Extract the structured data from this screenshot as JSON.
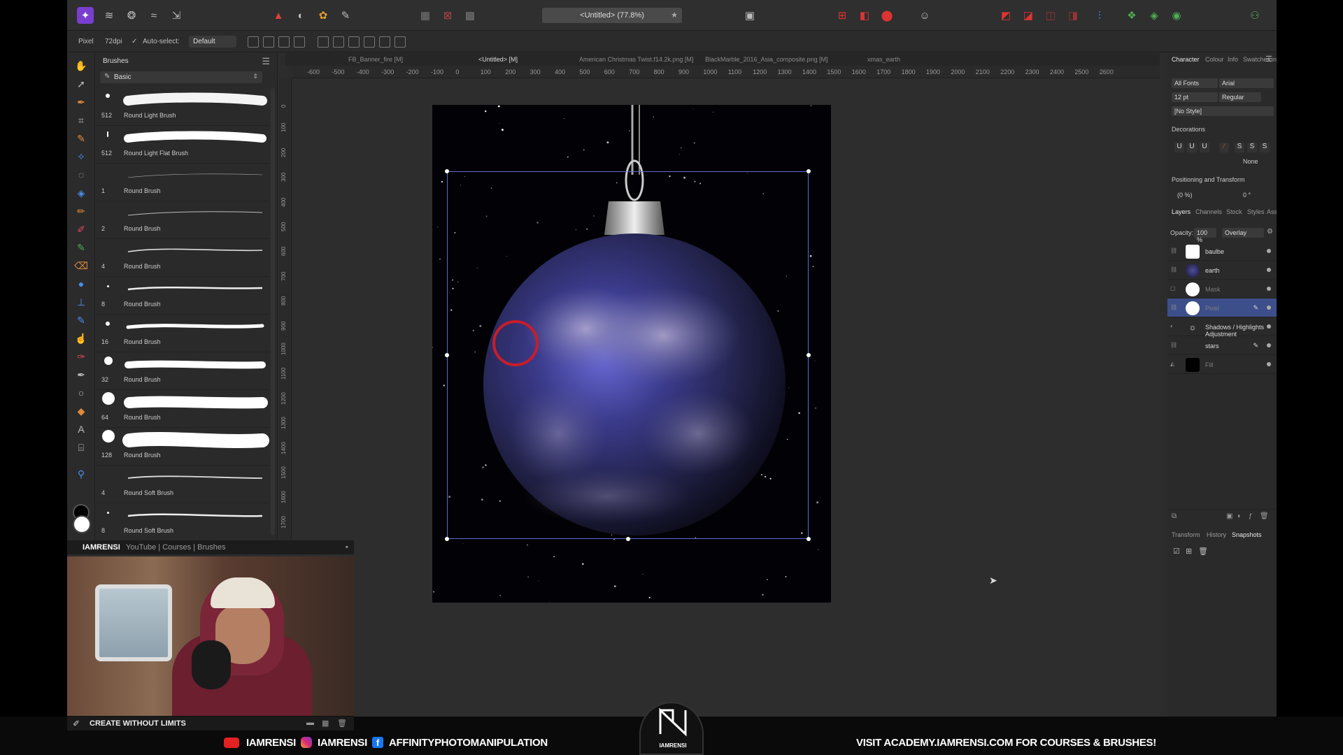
{
  "app": {
    "document_title": "<Untitled> (77.8%)",
    "colors": {
      "accent": "#3d4f8a",
      "selection": "#5b6bd1",
      "annotation_red": "#c81d2a"
    }
  },
  "context_toolbar": {
    "mode": "Pixel",
    "dpi": "72dpi",
    "auto_select_label": "Auto-select:",
    "auto_select_value": "Default"
  },
  "doc_tabs": [
    "FB_Banner_fire [M]",
    "<Untitled> [M]",
    "American Christmas Twist.f14.2k.png [M]",
    "BlackMarble_2016_Asia_composite.png [M]",
    "xmas_earth"
  ],
  "ruler_h": [
    "-600",
    "-500",
    "-400",
    "-300",
    "-200",
    "-100",
    "0",
    "100",
    "200",
    "300",
    "400",
    "500",
    "600",
    "700",
    "800",
    "900",
    "1000",
    "1100",
    "1200",
    "1300",
    "1400",
    "1500",
    "1600",
    "1700",
    "1800",
    "1900",
    "2000",
    "2100",
    "2200",
    "2300",
    "2400",
    "2500",
    "2600"
  ],
  "ruler_v": [
    "0",
    "100",
    "200",
    "300",
    "400",
    "500",
    "600",
    "700",
    "800",
    "900",
    "1000",
    "1100",
    "1200",
    "1300",
    "1400",
    "1500",
    "1600",
    "1700"
  ],
  "brushes": {
    "tab": "Brushes",
    "category": "Basic",
    "items": [
      {
        "size": "512",
        "name": "Round Light Brush"
      },
      {
        "size": "512",
        "name": "Round Light Flat Brush"
      },
      {
        "size": "1",
        "name": "Round Brush"
      },
      {
        "size": "2",
        "name": "Round Brush"
      },
      {
        "size": "4",
        "name": "Round Brush"
      },
      {
        "size": "8",
        "name": "Round Brush"
      },
      {
        "size": "16",
        "name": "Round Brush"
      },
      {
        "size": "32",
        "name": "Round Brush"
      },
      {
        "size": "64",
        "name": "Round Brush"
      },
      {
        "size": "128",
        "name": "Round Brush"
      },
      {
        "size": "4",
        "name": "Round Soft Brush"
      },
      {
        "size": "8",
        "name": "Round Soft Brush"
      }
    ]
  },
  "webcam": {
    "channel": "IAMRENSI",
    "links": "YouTube | Courses | Brushes",
    "motto": "CREATE WITHOUT LIMITS"
  },
  "character": {
    "tabs": [
      "Character",
      "Colour",
      "Info",
      "Swatches",
      "Links"
    ],
    "font_collection": "All Fonts",
    "font": "Arial",
    "size": "12 pt",
    "weight": "Regular",
    "style": "[No Style]",
    "decorations_label": "Decorations",
    "decorations_value": "None",
    "positioning_label": "Positioning and Transform",
    "baseline": "(0 %)",
    "shear": "0 °"
  },
  "layers_panel": {
    "tabs": [
      "Layers",
      "Channels",
      "Stock",
      "Styles",
      "Assets"
    ],
    "opacity_label": "Opacity:",
    "opacity": "100 %",
    "blend_mode": "Overlay",
    "layers": [
      {
        "name": "baulbe",
        "selected": false,
        "dim": false
      },
      {
        "name": "earth",
        "selected": false,
        "dim": false
      },
      {
        "name": "Mask",
        "selected": false,
        "dim": true
      },
      {
        "name": "Pixel",
        "selected": true,
        "dim": true
      },
      {
        "name": "Shadows / Highlights Adjustment",
        "selected": false,
        "dim": false
      },
      {
        "name": "stars",
        "selected": false,
        "dim": false
      },
      {
        "name": "Fill",
        "selected": false,
        "dim": true
      }
    ]
  },
  "history_panel": {
    "tabs": [
      "Transform",
      "History",
      "Snapshots"
    ]
  },
  "banner": {
    "youtube": "IAMRENSI",
    "instagram": "IAMRENSI",
    "facebook": "AFFINITYPHOTOMANIPULATION",
    "logo_text": "IAMRENSI",
    "cta": "VISIT ACADEMY.IAMRENSI.COM FOR COURSES & BRUSHES!"
  }
}
